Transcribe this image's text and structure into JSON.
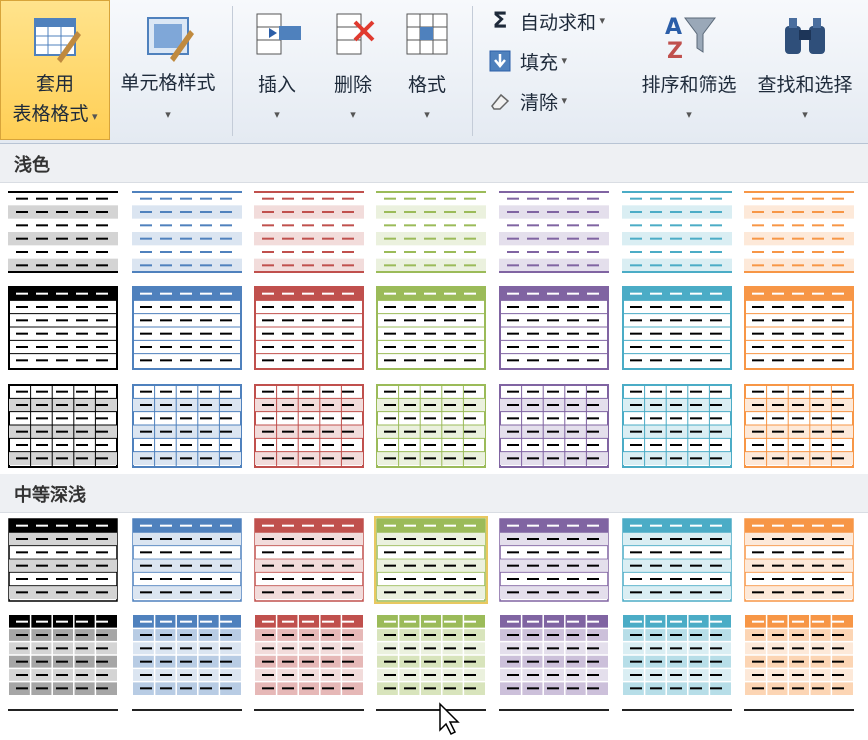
{
  "ribbon": {
    "table_format": {
      "line1": "套用",
      "line2": "表格格式"
    },
    "cell_style": {
      "label": "单元格样式"
    },
    "insert": {
      "label": "插入"
    },
    "delete": {
      "label": "删除"
    },
    "format": {
      "label": "格式"
    },
    "autosum": {
      "label": "自动求和"
    },
    "fill": {
      "label": "填充"
    },
    "clear": {
      "label": "清除"
    },
    "sort_filter": {
      "label": "排序和筛选"
    },
    "find_select": {
      "label": "查找和选择"
    }
  },
  "gallery": {
    "sections": [
      {
        "title": "浅色"
      },
      {
        "title": "中等深浅"
      }
    ]
  },
  "colors": {
    "black": "#000000",
    "blue": "#4f81bd",
    "red": "#c0504d",
    "green": "#9bbb59",
    "purple": "#8064a2",
    "aqua": "#4bacc6",
    "orange": "#f79646"
  },
  "icons": [
    "table-style-icon",
    "cell-style-icon",
    "insert-cells-icon",
    "delete-cells-icon",
    "format-cells-icon",
    "sigma-icon",
    "fill-down-icon",
    "eraser-icon",
    "sort-filter-icon",
    "binoculars-icon",
    "mouse-cursor-icon"
  ]
}
